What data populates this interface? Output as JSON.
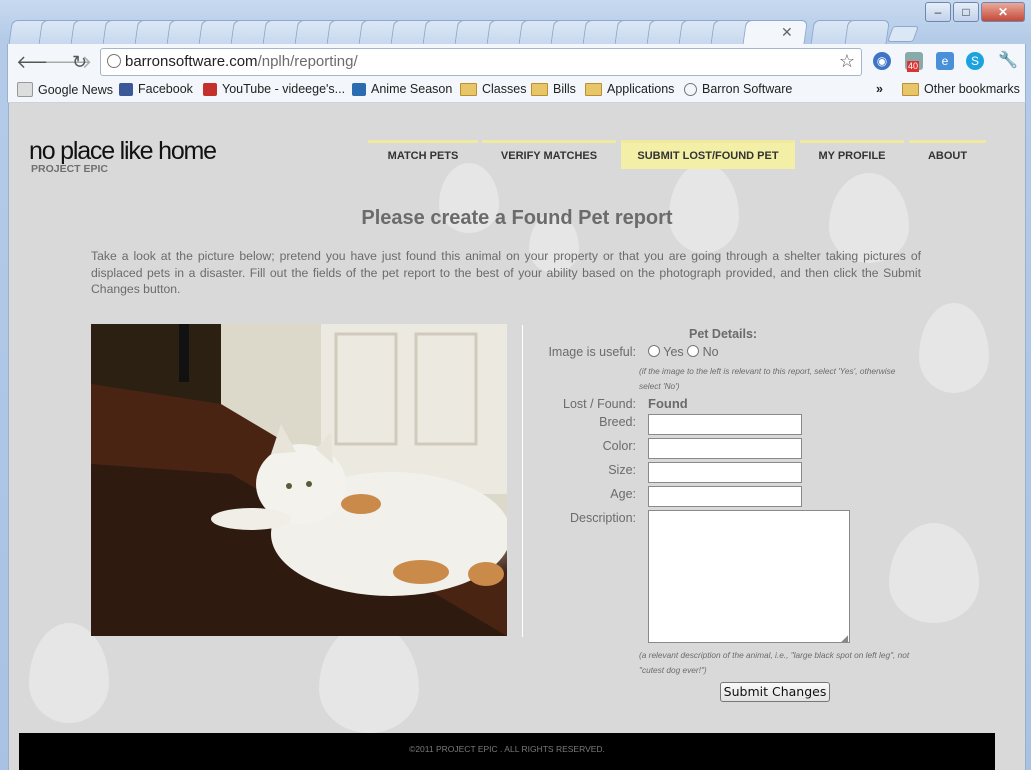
{
  "browser": {
    "url_host": "barronsoftware.com",
    "url_path": "/nplh/reporting/",
    "bookmarks": [
      {
        "label": "Google News",
        "icon": "google-news-icon"
      },
      {
        "label": "Facebook",
        "icon": "facebook-icon"
      },
      {
        "label": "YouTube - videege's...",
        "icon": "youtube-icon"
      },
      {
        "label": "Anime Season",
        "icon": "anime-season-icon"
      },
      {
        "label": "Classes",
        "icon": "folder-icon"
      },
      {
        "label": "Bills",
        "icon": "folder-icon"
      },
      {
        "label": "Applications",
        "icon": "folder-icon"
      },
      {
        "label": "Barron Software",
        "icon": "globe-icon"
      }
    ],
    "other_bookmarks": "Other bookmarks",
    "overflow": "»",
    "mail_badge": "40"
  },
  "site": {
    "logo": "no place like home",
    "logo_sub": "PROJECT EPIC",
    "nav": [
      "MATCH PETS",
      "VERIFY MATCHES",
      "SUBMIT LOST/FOUND PET",
      "MY PROFILE",
      "ABOUT"
    ],
    "active_nav": "SUBMIT LOST/FOUND PET",
    "heading": "Please create a Found Pet report",
    "intro": "Take a look at the picture below; pretend you have just found this animal on your property or that you are going through a shelter taking pictures of displaced pets in a disaster. Fill out the fields of the pet report to the best of your ability based on the photograph provided, and then click the Submit Changes button.",
    "form": {
      "section_title": "Pet Details:",
      "image_useful_label": "Image is useful:",
      "yes": "Yes",
      "no": "No",
      "image_note": "(if the image to the left is relevant to this report, select 'Yes', otherwise select 'No')",
      "lost_found_label": "Lost / Found:",
      "lost_found_value": "Found",
      "breed_label": "Breed:",
      "color_label": "Color:",
      "size_label": "Size:",
      "age_label": "Age:",
      "description_label": "Description:",
      "description_note": "(a relevant description of the animal, i.e., \"large black spot on left leg\", not \"cutest dog ever!\")",
      "submit": "Submit Changes"
    },
    "footer": "©2011 PROJECT EPIC . ALL RIGHTS RESERVED."
  }
}
